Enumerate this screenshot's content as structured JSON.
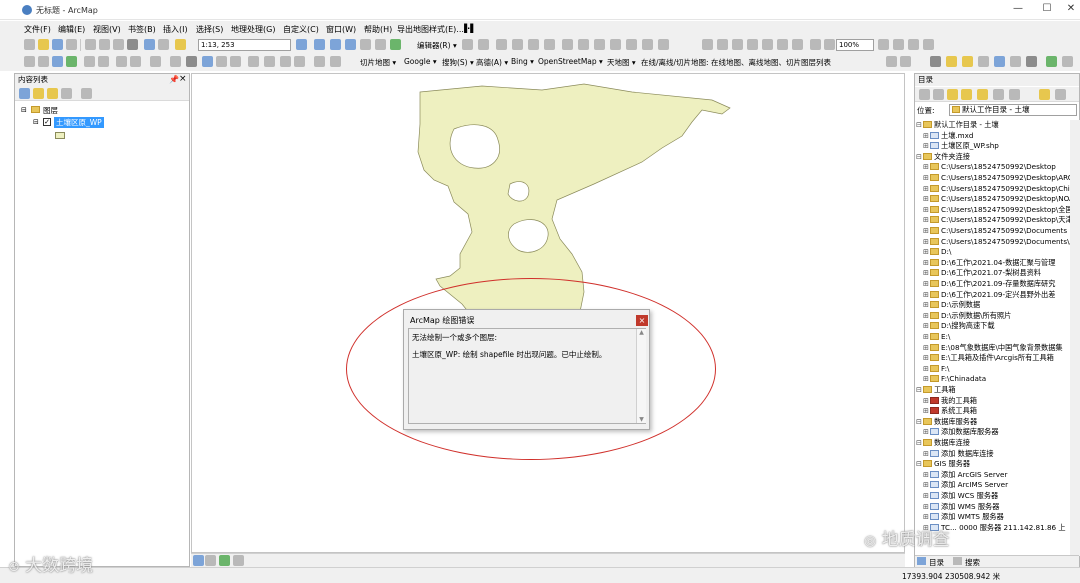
{
  "titlebar": {
    "title": "无标题 - ArcMap",
    "minimize": "—",
    "maximize": "☐",
    "close": "✕"
  },
  "menu": [
    "文件(F)",
    "编辑(E)",
    "视图(V)",
    "书签(B)",
    "插入(I)",
    "选择(S)",
    "地理处理(G)",
    "自定义(C)",
    "窗口(W)",
    "帮助(H)",
    "导出地图样式(E)..."
  ],
  "toolbar1": {
    "scale": "1:13, 253",
    "editor": "编辑器(R) ▾",
    "zoom": "100%"
  },
  "toolbar2": {
    "tiles": "切片地图 ▾",
    "google": "Google ▾",
    "search": "搜狗(S) ▾",
    "gaode": "高德(A) ▾",
    "bing": "Bing ▾",
    "osm": "OpenStreetMap ▾",
    "tianditu": "天地图 ▾",
    "offline": "在线/离线/切片地图: 在线地图、离线地图、切片图层列表"
  },
  "toc": {
    "title": "内容列表",
    "layers_label": "图层",
    "layer_name": "土壤区原_WP"
  },
  "catalog": {
    "title": "目录",
    "location_label": "位置:",
    "location_value": "默认工作目录 - 土壤",
    "items": [
      {
        "indent": 0,
        "text": "默认工作目录 - 土壤",
        "type": "folder"
      },
      {
        "indent": 1,
        "text": "土壤.mxd",
        "type": "file"
      },
      {
        "indent": 1,
        "text": "土壤区原_WP.shp",
        "type": "file"
      },
      {
        "indent": 0,
        "text": "文件夹连接",
        "type": "folder"
      },
      {
        "indent": 1,
        "text": "C:\\Users\\18524750992\\Desktop",
        "type": "folder"
      },
      {
        "indent": 1,
        "text": "C:\\Users\\18524750992\\Desktop\\ARCE",
        "type": "folder"
      },
      {
        "indent": 1,
        "text": "C:\\Users\\18524750992\\Desktop\\China",
        "type": "folder"
      },
      {
        "indent": 1,
        "text": "C:\\Users\\18524750992\\Desktop\\NOAT",
        "type": "folder"
      },
      {
        "indent": 1,
        "text": "C:\\Users\\18524750992\\Desktop\\全国",
        "type": "folder"
      },
      {
        "indent": 1,
        "text": "C:\\Users\\18524750992\\Desktop\\天津",
        "type": "folder"
      },
      {
        "indent": 1,
        "text": "C:\\Users\\18524750992\\Documents",
        "type": "folder"
      },
      {
        "indent": 1,
        "text": "C:\\Users\\18524750992\\Documents\\Ar",
        "type": "folder"
      },
      {
        "indent": 1,
        "text": "D:\\",
        "type": "folder"
      },
      {
        "indent": 1,
        "text": "D:\\6工作\\2021.04-数据汇聚与管理",
        "type": "folder"
      },
      {
        "indent": 1,
        "text": "D:\\6工作\\2021.07-梨树县资料",
        "type": "folder"
      },
      {
        "indent": 1,
        "text": "D:\\6工作\\2021.09-存量数据库研究",
        "type": "folder"
      },
      {
        "indent": 1,
        "text": "D:\\6工作\\2021.09-定兴县野外出差",
        "type": "folder"
      },
      {
        "indent": 1,
        "text": "D:\\示例数据",
        "type": "folder"
      },
      {
        "indent": 1,
        "text": "D:\\示例数据\\所有照片",
        "type": "folder"
      },
      {
        "indent": 1,
        "text": "D:\\搜狗高速下载",
        "type": "folder"
      },
      {
        "indent": 1,
        "text": "E:\\",
        "type": "folder"
      },
      {
        "indent": 1,
        "text": "E:\\08气象数据库\\中国气象背景数据集",
        "type": "folder"
      },
      {
        "indent": 1,
        "text": "E:\\工具箱及插件\\Arcgis所有工具箱",
        "type": "folder"
      },
      {
        "indent": 1,
        "text": "F:\\",
        "type": "folder"
      },
      {
        "indent": 1,
        "text": "F:\\Chinadata",
        "type": "folder"
      },
      {
        "indent": 0,
        "text": "工具箱",
        "type": "folder"
      },
      {
        "indent": 1,
        "text": "我的工具箱",
        "type": "tool"
      },
      {
        "indent": 1,
        "text": "系统工具箱",
        "type": "tool"
      },
      {
        "indent": 0,
        "text": "数据库服务器",
        "type": "folder"
      },
      {
        "indent": 1,
        "text": "添加数据库服务器",
        "type": "file"
      },
      {
        "indent": 0,
        "text": "数据库连接",
        "type": "folder"
      },
      {
        "indent": 1,
        "text": "添加 数据库连接",
        "type": "file"
      },
      {
        "indent": 0,
        "text": "GIS 服务器",
        "type": "folder"
      },
      {
        "indent": 1,
        "text": "添加 ArcGIS Server",
        "type": "file"
      },
      {
        "indent": 1,
        "text": "添加 ArcIMS Server",
        "type": "file"
      },
      {
        "indent": 1,
        "text": "添加 WCS 服务器",
        "type": "file"
      },
      {
        "indent": 1,
        "text": "添加 WMS 服务器",
        "type": "file"
      },
      {
        "indent": 1,
        "text": "添加 WMTS 服务器",
        "type": "file"
      },
      {
        "indent": 1,
        "text": "TC... 0000 服务器 211.142.81.86 上",
        "type": "file"
      }
    ],
    "tab_catalog": "目录",
    "tab_search": "搜索"
  },
  "dialog": {
    "title": "ArcMap 绘图错误",
    "close": "×",
    "line1": "无法绘制一个或多个图层:",
    "line2": "土壤区原_WP:  绘制 shapefile 时出现问题。已中止绘制。"
  },
  "status": {
    "coords": "17393.904  230508.942 米"
  },
  "watermarks": {
    "left": "大数跨境",
    "right": "地质调查"
  },
  "colors": {
    "polygon_fill": "#eef0c0",
    "polygon_stroke": "#8a8a5a",
    "ellipse": "#d0302b",
    "selection": "#3399ff"
  }
}
